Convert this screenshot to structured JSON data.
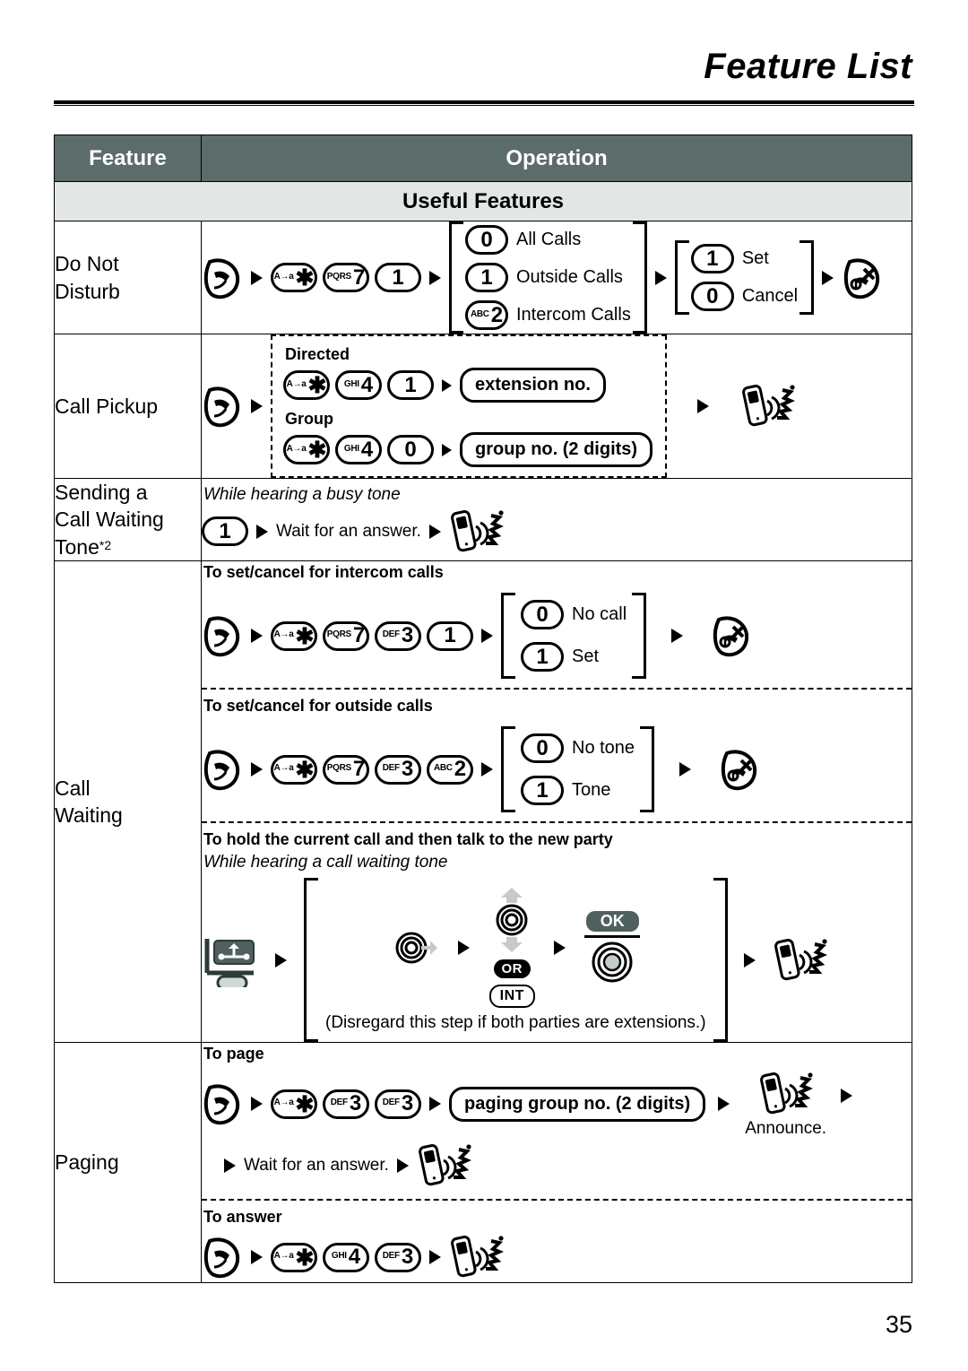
{
  "document": {
    "title": "Feature List",
    "page_number": "35"
  },
  "table": {
    "headers": {
      "feature": "Feature",
      "operation": "Operation"
    },
    "section_band": "Useful Features",
    "rows": [
      {
        "feature": "Do Not Disturb",
        "feature_lines": [
          "Do Not",
          "Disturb"
        ],
        "steps": {
          "talk_key": "talk-key",
          "codes": [
            "*",
            "7",
            "1"
          ],
          "code_labels": [
            "A→a",
            "PQRS",
            ""
          ],
          "options_1": [
            {
              "key": "0",
              "key_label": "",
              "text": "All Calls"
            },
            {
              "key": "1",
              "key_label": "",
              "text": "Outside Calls"
            },
            {
              "key": "2",
              "key_label": "ABC",
              "text": "Intercom Calls"
            }
          ],
          "options_2": [
            {
              "key": "1",
              "key_label": "",
              "text": "Set"
            },
            {
              "key": "0",
              "key_label": "",
              "text": "Cancel"
            }
          ],
          "end_key": "off-key"
        }
      },
      {
        "feature": "Call Pickup",
        "feature_lines": [
          "Call Pickup"
        ],
        "directed_label": "Directed",
        "directed_codes": [
          "*",
          "4",
          "1"
        ],
        "directed_code_labels": [
          "A→a",
          "GHI",
          ""
        ],
        "directed_box": "extension no.",
        "group_label": "Group",
        "group_codes": [
          "*",
          "4",
          "0"
        ],
        "group_code_labels": [
          "A→a",
          "GHI",
          ""
        ],
        "group_box": "group no. (2 digits)"
      },
      {
        "feature": "Sending a Call Waiting Tone*2",
        "feature_lines": [
          "Sending a",
          "Call Waiting",
          "Tone"
        ],
        "feature_sup": "*2",
        "condition": "While hearing a busy tone",
        "key": "1",
        "wait_text": "Wait for an answer."
      },
      {
        "feature": "Call Waiting",
        "feature_lines": [
          "Call",
          "Waiting"
        ],
        "blocks": [
          {
            "heading": "To set/cancel for intercom calls",
            "codes": [
              "*",
              "7",
              "3",
              "1"
            ],
            "code_labels": [
              "A→a",
              "PQRS",
              "DEF",
              ""
            ],
            "options": [
              {
                "key": "0",
                "text": "No call"
              },
              {
                "key": "1",
                "text": "Set"
              }
            ]
          },
          {
            "heading": "To set/cancel for outside calls",
            "codes": [
              "*",
              "7",
              "3",
              "2"
            ],
            "code_labels": [
              "A→a",
              "PQRS",
              "DEF",
              "ABC"
            ],
            "options": [
              {
                "key": "0",
                "text": "No tone"
              },
              {
                "key": "1",
                "text": "Tone"
              }
            ]
          },
          {
            "heading": "To hold the current call and then talk to the new party",
            "condition": "While hearing a call waiting tone",
            "or_label": "OR",
            "int_label": "INT",
            "ok_label": "OK",
            "note": "(Disregard this step if both parties are extensions.)"
          }
        ]
      },
      {
        "feature": "Paging",
        "feature_lines": [
          "Paging"
        ],
        "to_page_heading": "To page",
        "to_page_codes": [
          "*",
          "3",
          "3"
        ],
        "to_page_code_labels": [
          "A→a",
          "DEF",
          "DEF"
        ],
        "to_page_box": "paging group no. (2 digits)",
        "announce": "Announce.",
        "wait_text": "Wait for an answer.",
        "to_answer_heading": "To answer",
        "to_answer_codes": [
          "*",
          "4",
          "3"
        ],
        "to_answer_code_labels": [
          "A→a",
          "GHI",
          "DEF"
        ]
      }
    ]
  },
  "colors": {
    "header_bg": "#5c6c6a",
    "band_bg": "#e2e7e5",
    "ok_cap": "#4f605e",
    "ink": "#000000"
  }
}
